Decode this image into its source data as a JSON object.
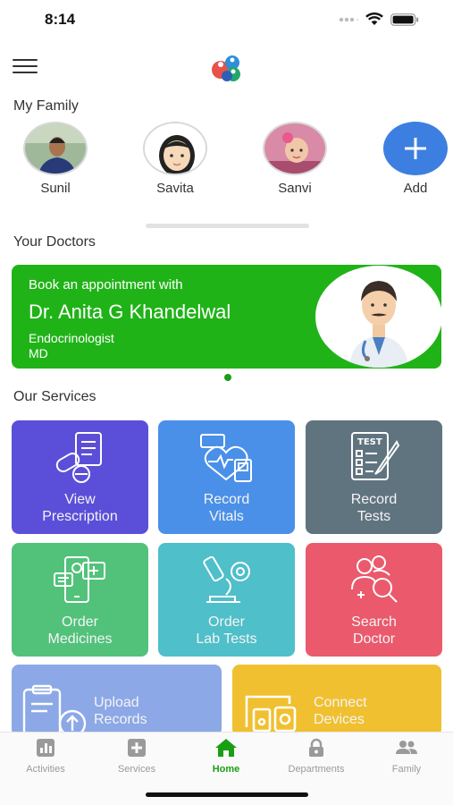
{
  "status_bar": {
    "time": "8:14"
  },
  "family": {
    "title": "My Family",
    "members": [
      {
        "name": "Sunil"
      },
      {
        "name": "Savita"
      },
      {
        "name": "Sanvi"
      }
    ],
    "add_label": "Add"
  },
  "doctors": {
    "title": "Your Doctors",
    "card": {
      "line1": "Book an appointment with",
      "doctor_name": "Dr. Anita G Khandelwal",
      "specialty": "Endocrinologist",
      "degree": "MD"
    }
  },
  "services": {
    "title": "Our Services",
    "tiles": [
      {
        "line1": "View",
        "line2": "Prescription",
        "color": "#5b4fd9",
        "icon": "pills-prescription-icon"
      },
      {
        "line1": "Record",
        "line2": "Vitals",
        "color": "#4a90e8",
        "icon": "heart-vitals-icon"
      },
      {
        "line1": "Record",
        "line2": "Tests",
        "color": "#607480",
        "icon": "test-clipboard-icon"
      },
      {
        "line1": "Order",
        "line2": "Medicines",
        "color": "#52c27a",
        "icon": "phone-medicine-icon"
      },
      {
        "line1": "Order",
        "line2": "Lab Tests",
        "color": "#4fbfc9",
        "icon": "microscope-icon"
      },
      {
        "line1": "Search",
        "line2": "Doctor",
        "color": "#ea5a6c",
        "icon": "doctor-search-icon"
      }
    ],
    "wide_tiles": [
      {
        "line1": "Upload",
        "line2": "Records",
        "color": "#8ca8e6",
        "icon": "upload-records-icon"
      },
      {
        "line1": "Connect",
        "line2": "Devices",
        "color": "#f0c030",
        "icon": "devices-icon"
      }
    ]
  },
  "tab_bar": {
    "tabs": [
      {
        "label": "Activities",
        "icon": "chart-icon"
      },
      {
        "label": "Services",
        "icon": "plus-box-icon"
      },
      {
        "label": "Home",
        "icon": "home-icon",
        "active": true
      },
      {
        "label": "Departments",
        "icon": "lock-icon"
      },
      {
        "label": "Family",
        "icon": "people-icon"
      }
    ],
    "active_color": "#1a9f14"
  }
}
